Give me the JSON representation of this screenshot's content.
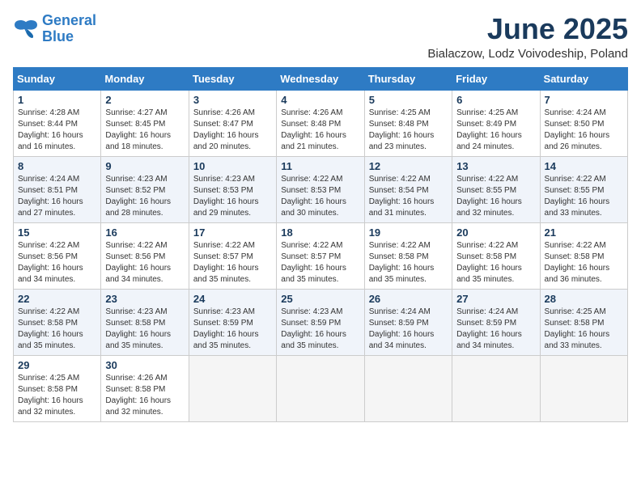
{
  "header": {
    "logo_line1": "General",
    "logo_line2": "Blue",
    "month_title": "June 2025",
    "location": "Bialaczow, Lodz Voivodeship, Poland"
  },
  "weekdays": [
    "Sunday",
    "Monday",
    "Tuesday",
    "Wednesday",
    "Thursday",
    "Friday",
    "Saturday"
  ],
  "weeks": [
    [
      {
        "day": "1",
        "rise": "Sunrise: 4:28 AM",
        "set": "Sunset: 8:44 PM",
        "daylight": "Daylight: 16 hours and 16 minutes."
      },
      {
        "day": "2",
        "rise": "Sunrise: 4:27 AM",
        "set": "Sunset: 8:45 PM",
        "daylight": "Daylight: 16 hours and 18 minutes."
      },
      {
        "day": "3",
        "rise": "Sunrise: 4:26 AM",
        "set": "Sunset: 8:47 PM",
        "daylight": "Daylight: 16 hours and 20 minutes."
      },
      {
        "day": "4",
        "rise": "Sunrise: 4:26 AM",
        "set": "Sunset: 8:48 PM",
        "daylight": "Daylight: 16 hours and 21 minutes."
      },
      {
        "day": "5",
        "rise": "Sunrise: 4:25 AM",
        "set": "Sunset: 8:48 PM",
        "daylight": "Daylight: 16 hours and 23 minutes."
      },
      {
        "day": "6",
        "rise": "Sunrise: 4:25 AM",
        "set": "Sunset: 8:49 PM",
        "daylight": "Daylight: 16 hours and 24 minutes."
      },
      {
        "day": "7",
        "rise": "Sunrise: 4:24 AM",
        "set": "Sunset: 8:50 PM",
        "daylight": "Daylight: 16 hours and 26 minutes."
      }
    ],
    [
      {
        "day": "8",
        "rise": "Sunrise: 4:24 AM",
        "set": "Sunset: 8:51 PM",
        "daylight": "Daylight: 16 hours and 27 minutes."
      },
      {
        "day": "9",
        "rise": "Sunrise: 4:23 AM",
        "set": "Sunset: 8:52 PM",
        "daylight": "Daylight: 16 hours and 28 minutes."
      },
      {
        "day": "10",
        "rise": "Sunrise: 4:23 AM",
        "set": "Sunset: 8:53 PM",
        "daylight": "Daylight: 16 hours and 29 minutes."
      },
      {
        "day": "11",
        "rise": "Sunrise: 4:22 AM",
        "set": "Sunset: 8:53 PM",
        "daylight": "Daylight: 16 hours and 30 minutes."
      },
      {
        "day": "12",
        "rise": "Sunrise: 4:22 AM",
        "set": "Sunset: 8:54 PM",
        "daylight": "Daylight: 16 hours and 31 minutes."
      },
      {
        "day": "13",
        "rise": "Sunrise: 4:22 AM",
        "set": "Sunset: 8:55 PM",
        "daylight": "Daylight: 16 hours and 32 minutes."
      },
      {
        "day": "14",
        "rise": "Sunrise: 4:22 AM",
        "set": "Sunset: 8:55 PM",
        "daylight": "Daylight: 16 hours and 33 minutes."
      }
    ],
    [
      {
        "day": "15",
        "rise": "Sunrise: 4:22 AM",
        "set": "Sunset: 8:56 PM",
        "daylight": "Daylight: 16 hours and 34 minutes."
      },
      {
        "day": "16",
        "rise": "Sunrise: 4:22 AM",
        "set": "Sunset: 8:56 PM",
        "daylight": "Daylight: 16 hours and 34 minutes."
      },
      {
        "day": "17",
        "rise": "Sunrise: 4:22 AM",
        "set": "Sunset: 8:57 PM",
        "daylight": "Daylight: 16 hours and 35 minutes."
      },
      {
        "day": "18",
        "rise": "Sunrise: 4:22 AM",
        "set": "Sunset: 8:57 PM",
        "daylight": "Daylight: 16 hours and 35 minutes."
      },
      {
        "day": "19",
        "rise": "Sunrise: 4:22 AM",
        "set": "Sunset: 8:58 PM",
        "daylight": "Daylight: 16 hours and 35 minutes."
      },
      {
        "day": "20",
        "rise": "Sunrise: 4:22 AM",
        "set": "Sunset: 8:58 PM",
        "daylight": "Daylight: 16 hours and 35 minutes."
      },
      {
        "day": "21",
        "rise": "Sunrise: 4:22 AM",
        "set": "Sunset: 8:58 PM",
        "daylight": "Daylight: 16 hours and 36 minutes."
      }
    ],
    [
      {
        "day": "22",
        "rise": "Sunrise: 4:22 AM",
        "set": "Sunset: 8:58 PM",
        "daylight": "Daylight: 16 hours and 35 minutes."
      },
      {
        "day": "23",
        "rise": "Sunrise: 4:23 AM",
        "set": "Sunset: 8:58 PM",
        "daylight": "Daylight: 16 hours and 35 minutes."
      },
      {
        "day": "24",
        "rise": "Sunrise: 4:23 AM",
        "set": "Sunset: 8:59 PM",
        "daylight": "Daylight: 16 hours and 35 minutes."
      },
      {
        "day": "25",
        "rise": "Sunrise: 4:23 AM",
        "set": "Sunset: 8:59 PM",
        "daylight": "Daylight: 16 hours and 35 minutes."
      },
      {
        "day": "26",
        "rise": "Sunrise: 4:24 AM",
        "set": "Sunset: 8:59 PM",
        "daylight": "Daylight: 16 hours and 34 minutes."
      },
      {
        "day": "27",
        "rise": "Sunrise: 4:24 AM",
        "set": "Sunset: 8:59 PM",
        "daylight": "Daylight: 16 hours and 34 minutes."
      },
      {
        "day": "28",
        "rise": "Sunrise: 4:25 AM",
        "set": "Sunset: 8:58 PM",
        "daylight": "Daylight: 16 hours and 33 minutes."
      }
    ],
    [
      {
        "day": "29",
        "rise": "Sunrise: 4:25 AM",
        "set": "Sunset: 8:58 PM",
        "daylight": "Daylight: 16 hours and 32 minutes."
      },
      {
        "day": "30",
        "rise": "Sunrise: 4:26 AM",
        "set": "Sunset: 8:58 PM",
        "daylight": "Daylight: 16 hours and 32 minutes."
      },
      null,
      null,
      null,
      null,
      null
    ]
  ]
}
